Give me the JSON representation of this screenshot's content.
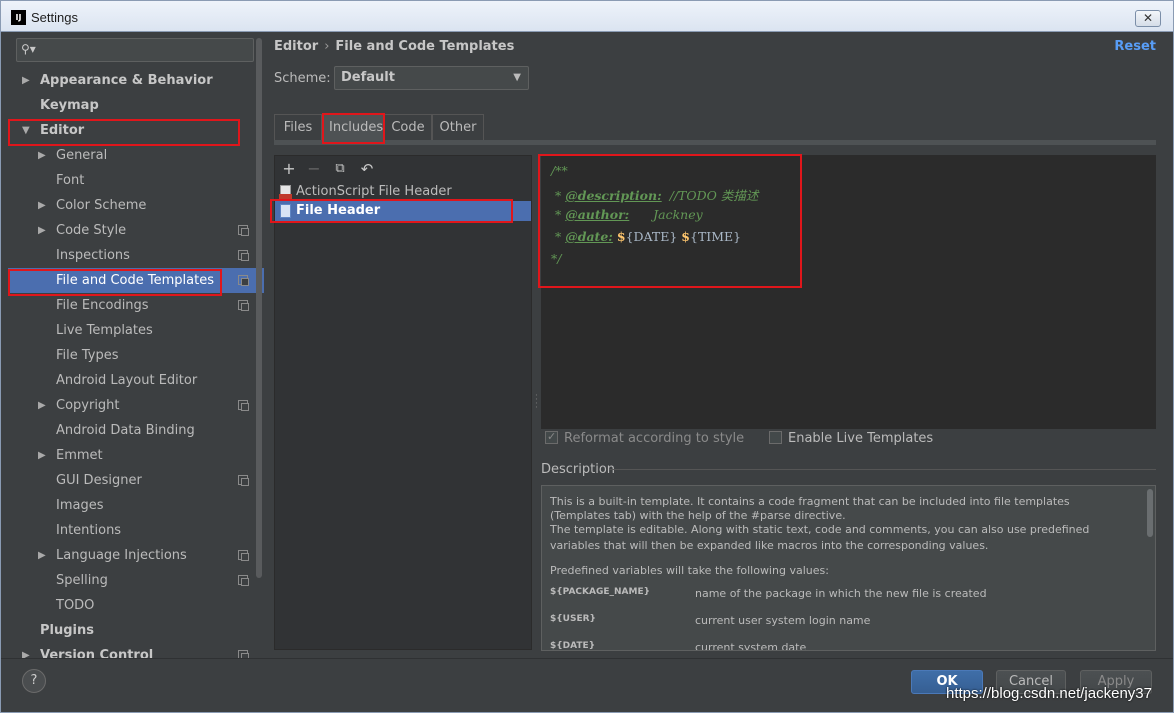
{
  "window": {
    "title": "Settings",
    "app_icon": "IJ"
  },
  "search": {
    "placeholder": ""
  },
  "sidebar": {
    "items": [
      {
        "label": "Appearance & Behavior"
      },
      {
        "label": "Keymap"
      },
      {
        "label": "Editor"
      },
      {
        "label": "General"
      },
      {
        "label": "Font"
      },
      {
        "label": "Color Scheme"
      },
      {
        "label": "Code Style"
      },
      {
        "label": "Inspections"
      },
      {
        "label": "File and Code Templates"
      },
      {
        "label": "File Encodings"
      },
      {
        "label": "Live Templates"
      },
      {
        "label": "File Types"
      },
      {
        "label": "Android Layout Editor"
      },
      {
        "label": "Copyright"
      },
      {
        "label": "Android Data Binding"
      },
      {
        "label": "Emmet"
      },
      {
        "label": "GUI Designer"
      },
      {
        "label": "Images"
      },
      {
        "label": "Intentions"
      },
      {
        "label": "Language Injections"
      },
      {
        "label": "Spelling"
      },
      {
        "label": "TODO"
      },
      {
        "label": "Plugins"
      },
      {
        "label": "Version Control"
      }
    ]
  },
  "header": {
    "crumb1": "Editor",
    "sep": "›",
    "crumb2": "File and Code Templates",
    "reset": "Reset"
  },
  "scheme": {
    "label": "Scheme:",
    "value": "Default"
  },
  "tabs": [
    "Files",
    "Includes",
    "Code",
    "Other"
  ],
  "templates": [
    "ActionScript File Header",
    "File Header"
  ],
  "editor": {
    "l1": "/**",
    "l2_prefix": " * ",
    "l2_tag": "@description:",
    "l2_rest": "  //TODO 类描述",
    "l3_prefix": " * ",
    "l3_tag": "@author:",
    "l3_rest": "      Jackney",
    "l4_prefix": " * ",
    "l4_tag": "@date:",
    "l4_d1": "$",
    "l4_v1": "{DATE}",
    "l4_d2": "$",
    "l4_v2": "{TIME}",
    "l5": "*/"
  },
  "options": {
    "reformat": "Reformat according to style",
    "live": "Enable Live Templates"
  },
  "description": {
    "label": "Description",
    "p1a": "This is a built-in template. It contains a code fragment that can be included into file templates",
    "p1b": "(Templates tab) with the help of the #parse directive.",
    "p1c": "The template is editable. Along with static text, code and comments, you can also use predefined",
    "p1d": "variables that will then be expanded like macros into the corresponding values.",
    "p2": "Predefined variables will take the following values:",
    "vars": [
      {
        "name": "${PACKAGE_NAME}",
        "value": "name of the package in which the new file is created"
      },
      {
        "name": "${USER}",
        "value": "current user system login name"
      },
      {
        "name": "${DATE}",
        "value": "current system date"
      }
    ]
  },
  "buttons": {
    "help": "?",
    "ok": "OK",
    "cancel": "Cancel",
    "apply": "Apply"
  },
  "watermark": "https://blog.csdn.net/jackeny37"
}
